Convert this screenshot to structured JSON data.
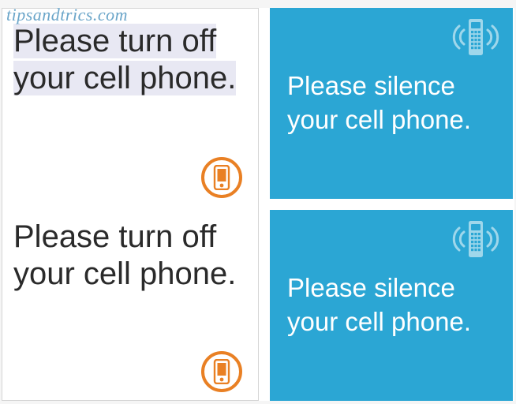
{
  "watermark": "tipsandtrics.com",
  "left": {
    "cards": [
      {
        "text": "Please turn off your cell phone."
      },
      {
        "text": "Please turn off your cell phone."
      }
    ],
    "icon_name": "phone-icon",
    "accent_color": "#e98024"
  },
  "right": {
    "cards": [
      {
        "text": "Please silence your cell phone."
      },
      {
        "text": "Please silence your cell phone."
      }
    ],
    "icon_name": "phone-ringing-icon",
    "bg_color": "#2ba6d4"
  }
}
